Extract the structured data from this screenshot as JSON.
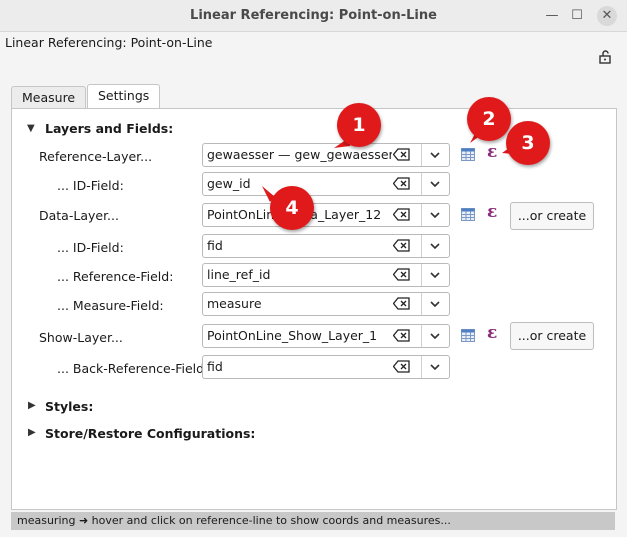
{
  "window": {
    "title": "Linear Referencing: Point-on-Line"
  },
  "dock": {
    "title": "Linear Referencing: Point-on-Line"
  },
  "tabs": [
    {
      "label": "Measure"
    },
    {
      "label": "Settings"
    }
  ],
  "sections": {
    "layers": "Layers and Fields:",
    "styles": "Styles:",
    "store": "Store/Restore Configurations:"
  },
  "fields": {
    "reference_layer": {
      "label": "Reference-Layer...",
      "value": "gewaesser — gew_gewaesser"
    },
    "ref_id_field": {
      "label": "... ID-Field:",
      "value": "gew_id"
    },
    "data_layer": {
      "label": "Data-Layer...",
      "value": "PointOnLine_Data_Layer_12"
    },
    "data_id_field": {
      "label": "... ID-Field:",
      "value": "fid"
    },
    "reference_field": {
      "label": "... Reference-Field:",
      "value": "line_ref_id"
    },
    "measure_field": {
      "label": "... Measure-Field:",
      "value": "measure"
    },
    "show_layer": {
      "label": "Show-Layer...",
      "value": "PointOnLine_Show_Layer_1"
    },
    "back_ref_field": {
      "label": "... Back-Reference-Field:",
      "value": "fid"
    }
  },
  "buttons": {
    "or_create": "...or create"
  },
  "expr_glyph": "ε",
  "callouts": [
    "1",
    "2",
    "3",
    "4"
  ],
  "status": "measuring ➜ hover and click on reference-line to show coords and measures...",
  "colors": {
    "callout": "#e0191b",
    "expression": "#8a2a7a"
  }
}
